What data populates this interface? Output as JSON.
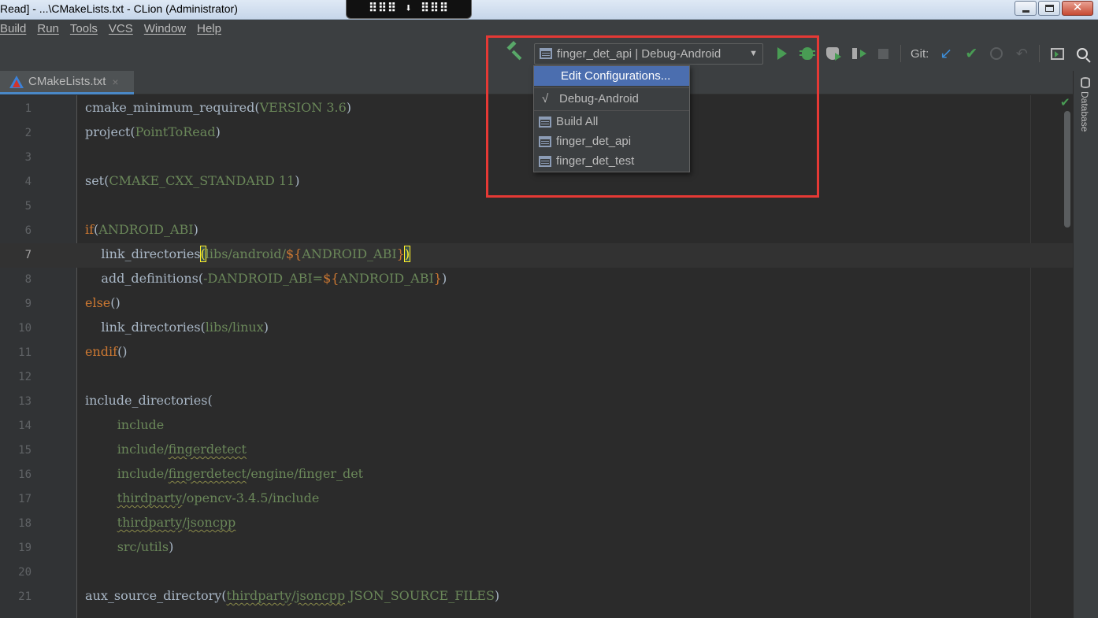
{
  "window": {
    "title": "Read] - ...\\CMakeLists.txt - CLion (Administrator)",
    "download_widget": "⠿⠿⠿ ⬇ ⠿⠿⠿"
  },
  "menu": [
    "Build",
    "Run",
    "Tools",
    "VCS",
    "Window",
    "Help"
  ],
  "toolbar": {
    "config_selector": "finger_det_api | Debug-Android",
    "git_label": "Git:",
    "icons": [
      "hammer-icon",
      "cmake-config-icon",
      "run-icon",
      "debug-icon",
      "coverage-icon",
      "profiler-icon",
      "stop-icon",
      "git-update-icon",
      "git-commit-icon",
      "history-icon",
      "revert-icon",
      "terminal-icon",
      "search-icon"
    ]
  },
  "tab": {
    "label": "CMakeLists.txt",
    "close": "×"
  },
  "right_strip": {
    "label": "Database"
  },
  "config_dropdown": {
    "edit": "Edit Configurations...",
    "profile": "Debug-Android",
    "profile_check": "√",
    "targets": [
      "Build All",
      "finger_det_api",
      "finger_det_test"
    ]
  },
  "editor": {
    "current_line": 7,
    "line_numbers": [
      "1",
      "2",
      "3",
      "4",
      "5",
      "6",
      "7",
      "8",
      "9",
      "10",
      "11",
      "12",
      "13",
      "14",
      "15",
      "16",
      "17",
      "18",
      "19",
      "20",
      "21"
    ],
    "lines": [
      "cmake_minimum_required(VERSION 3.6)",
      "project(PointToRead)",
      "",
      "set(CMAKE_CXX_STANDARD 11)",
      "",
      "if(ANDROID_ABI)",
      "    link_directories(libs/android/${ANDROID_ABI})",
      "    add_definitions(-DANDROID_ABI=${ANDROID_ABI})",
      "else()",
      "    link_directories(libs/linux)",
      "endif()",
      "",
      "include_directories(",
      "        include",
      "        include/fingerdetect",
      "        include/fingerdetect/engine/finger_det",
      "        thirdparty/opencv-3.4.5/include",
      "        thirdparty/jsoncpp",
      "        src/utils)",
      "",
      "aux_source_directory(thirdparty/jsoncpp JSON_SOURCE_FILES)"
    ]
  },
  "colors": {
    "accent": "#4b6eaf",
    "highlight_box": "#e53935",
    "run_green": "#499c54",
    "git_blue": "#3d8ed8"
  }
}
